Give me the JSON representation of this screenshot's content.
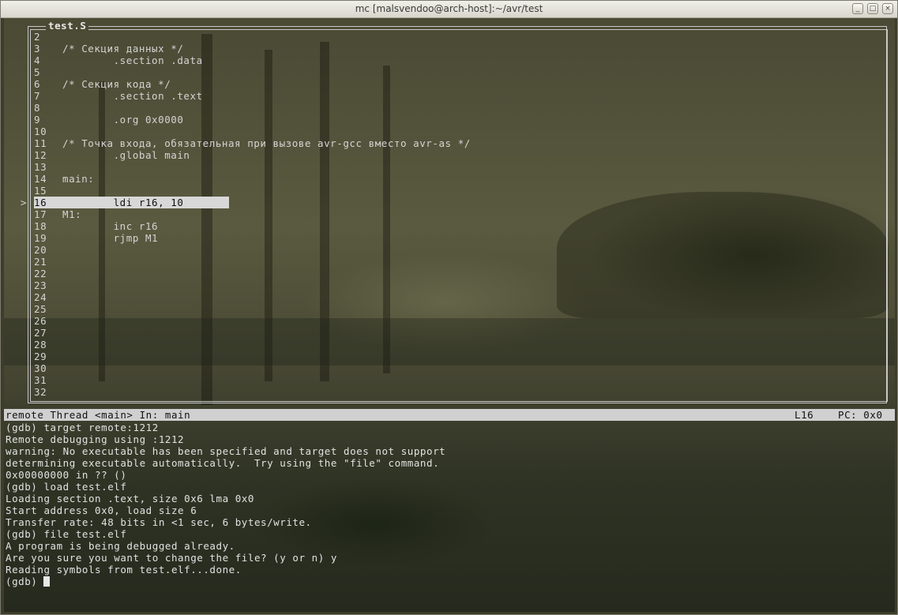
{
  "window": {
    "title": "mc [malsvendoo@arch-host]:~/avr/test",
    "buttons": {
      "minimize": "_",
      "maximize": "□",
      "close": "×"
    }
  },
  "source": {
    "title": "test.S",
    "current_marker": ">",
    "lines": [
      {
        "num": "2",
        "text": ""
      },
      {
        "num": "3",
        "text": "         /* Секция данных */"
      },
      {
        "num": "4",
        "text": "                 .section .data"
      },
      {
        "num": "5",
        "text": ""
      },
      {
        "num": "6",
        "text": "         /* Секция кода */"
      },
      {
        "num": "7",
        "text": "                 .section .text"
      },
      {
        "num": "8",
        "text": ""
      },
      {
        "num": "9",
        "text": "                 .org 0x0000"
      },
      {
        "num": "10",
        "text": ""
      },
      {
        "num": "11",
        "text": "         /* Точка входа, обязательная при вызове avr-gcc вместо avr-as */"
      },
      {
        "num": "12",
        "text": "                 .global main"
      },
      {
        "num": "13",
        "text": ""
      },
      {
        "num": "14",
        "text": "         main:"
      },
      {
        "num": "15",
        "text": ""
      },
      {
        "num": "16",
        "text": "                 ldi r16, 10",
        "current": true
      },
      {
        "num": "17",
        "text": "         M1:"
      },
      {
        "num": "18",
        "text": "                 inc r16"
      },
      {
        "num": "19",
        "text": "                 rjmp M1"
      },
      {
        "num": "20",
        "text": ""
      },
      {
        "num": "21",
        "text": ""
      },
      {
        "num": "22",
        "text": ""
      },
      {
        "num": "23",
        "text": ""
      },
      {
        "num": "24",
        "text": ""
      },
      {
        "num": "25",
        "text": ""
      },
      {
        "num": "26",
        "text": ""
      },
      {
        "num": "27",
        "text": ""
      },
      {
        "num": "28",
        "text": ""
      },
      {
        "num": "29",
        "text": ""
      },
      {
        "num": "30",
        "text": ""
      },
      {
        "num": "31",
        "text": ""
      },
      {
        "num": "32",
        "text": ""
      }
    ]
  },
  "status": {
    "left": "remote Thread <main> In: main",
    "line": "L16",
    "pc": "PC: 0x0"
  },
  "gdb": {
    "lines": [
      "(gdb) target remote:1212",
      "Remote debugging using :1212",
      "warning: No executable has been specified and target does not support",
      "determining executable automatically.  Try using the \"file\" command.",
      "0x00000000 in ?? ()",
      "(gdb) load test.elf",
      "Loading section .text, size 0x6 lma 0x0",
      "Start address 0x0, load size 6",
      "Transfer rate: 48 bits in <1 sec, 6 bytes/write.",
      "(gdb) file test.elf",
      "A program is being debugged already.",
      "Are you sure you want to change the file? (y or n) y",
      "Reading symbols from test.elf...done."
    ],
    "prompt": "(gdb) "
  }
}
